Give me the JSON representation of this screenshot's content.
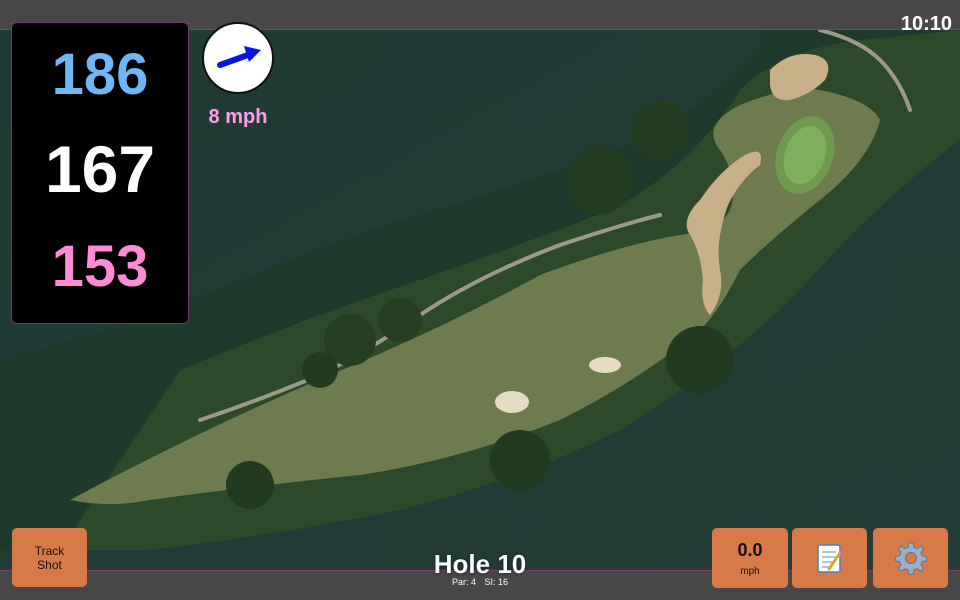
{
  "status": {
    "time": "10:10"
  },
  "distances": {
    "back": {
      "value": "186",
      "color": "#6fb6f6"
    },
    "middle": {
      "value": "167",
      "color": "#ffffff"
    },
    "front": {
      "value": "153",
      "color": "#ff8ad6"
    }
  },
  "wind": {
    "speed_label": "8 mph",
    "arrow_color": "#0a14e6",
    "icon": "wind-arrow-icon"
  },
  "hole": {
    "title": "Hole 10",
    "par": "Par: 4",
    "stroke_index": "SI: 16"
  },
  "buttons": {
    "track_shot_line1": "Track",
    "track_shot_line2": "Shot",
    "speed_value": "0.0",
    "speed_unit": "mph",
    "notes_icon": "notepad-icon",
    "settings_icon": "gear-icon"
  },
  "colors": {
    "button": "#d77a47",
    "bar": "#474747",
    "accent_border": "#7a3d7a"
  }
}
